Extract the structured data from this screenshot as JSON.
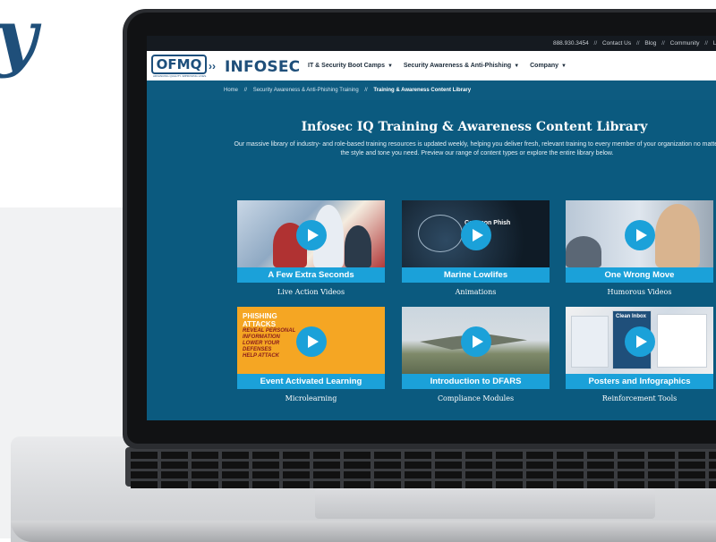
{
  "utility_bar": {
    "phone": "888.930.3454",
    "separator": "//",
    "links": [
      "Contact Us",
      "Blog",
      "Community",
      "Lo"
    ]
  },
  "header": {
    "logo_text": "OFMQ",
    "logo_chevrons": "››",
    "logo_tagline": "ADVANCING QUALITY. IMPROVING LIVES.",
    "brand": "INFOSEC",
    "nav": [
      {
        "label": "IT & Security Boot Camps"
      },
      {
        "label": "Security Awareness & Anti-Phishing"
      },
      {
        "label": "Company"
      }
    ]
  },
  "breadcrumb": {
    "items": [
      "Home",
      "Security Awareness & Anti-Phishing Training",
      "Training & Awareness Content Library"
    ],
    "separator": "//"
  },
  "hero": {
    "title": "Infosec IQ Training & Awareness Content Library",
    "intro": "Our massive library of industry- and role-based training resources is updated weekly, helping you deliver fresh, relevant training to every member of your organization no matter the style and tone you need. Preview our range of content types or explore the entire library below."
  },
  "cards": [
    {
      "caption": "A Few Extra Seconds",
      "type": "Live Action Videos"
    },
    {
      "caption": "Marine Lowlifes",
      "type": "Animations",
      "thumb_title": "Common Phish",
      "thumb_sub": "..."
    },
    {
      "caption": "One Wrong Move",
      "type": "Humorous Videos"
    },
    {
      "caption": "Event Activated Learning",
      "type": "Microlearning",
      "thumb_lines": [
        "PHISHING",
        "ATTACKS"
      ],
      "thumb_red": [
        "REVEAL PERSONAL",
        "INFORMATION",
        "LOWER YOUR",
        "DEFENSES",
        "HELP ATTACK"
      ]
    },
    {
      "caption": "Introduction to DFARS",
      "type": "Compliance Modules"
    },
    {
      "caption": "Posters and Infographics",
      "type": "Reinforcement Tools",
      "thumb_title": "Clean Inbox"
    }
  ],
  "colors": {
    "page_bg": "#0b5a7f",
    "accent": "#1ba1d9",
    "brand": "#1f4f7a"
  },
  "icons": {
    "play": "play-icon",
    "caret": "chevron-down-icon"
  }
}
